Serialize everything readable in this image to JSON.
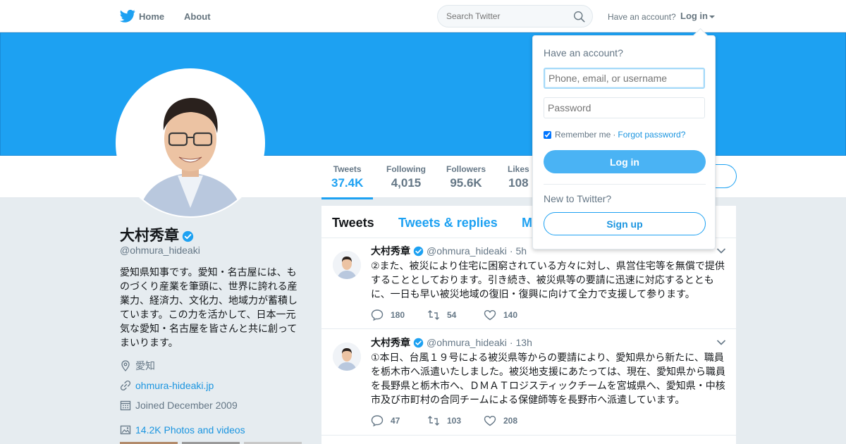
{
  "nav": {
    "home_label": "Home",
    "about_label": "About",
    "search_placeholder": "Search Twitter",
    "have_account": "Have an account?",
    "login_label": "Log in"
  },
  "profile": {
    "name": "大村秀章",
    "handle": "@ohmura_hideaki",
    "bio": "愛知県知事です。愛知・名古屋には、ものづくり産業を筆頭に、世界に誇れる産業力、経済力、文化力、地域力が蓄積しています。この力を活かして、日本一元気な愛知・名古屋を皆さんと共に創ってまいります。",
    "location": "愛知",
    "website": "ohmura-hideaki.jp",
    "joined": "Joined December 2009",
    "photos": "14.2K Photos and videos"
  },
  "stats": [
    {
      "label": "Tweets",
      "value": "37.4K"
    },
    {
      "label": "Following",
      "value": "4,015"
    },
    {
      "label": "Followers",
      "value": "95.6K"
    },
    {
      "label": "Likes",
      "value": "108"
    }
  ],
  "tabs": [
    "Tweets",
    "Tweets & replies",
    "M"
  ],
  "tweets": [
    {
      "name": "大村秀章",
      "handle": "@ohmura_hideaki",
      "sep": "·",
      "time": "5h",
      "text": "②また、被災により住宅に困窮されている方々に対し、県営住宅等を無償で提供することとしております。引き続き、被災県等の要請に迅速に対応するとともに、一日も早い被災地域の復旧・復興に向けて全力で支援して参ります。",
      "replies": "180",
      "retweets": "54",
      "likes": "140"
    },
    {
      "name": "大村秀章",
      "handle": "@ohmura_hideaki",
      "sep": "·",
      "time": "13h",
      "text": "①本日、台風１９号による被災県等からの要請により、愛知県から新たに、職員を栃木市へ派遣いたしました。被災地支援にあたっては、現在、愛知県から職員を長野県と栃木市へ、ＤＭＡＴロジスティックチームを宮城県へ、愛知県・中核市及び市町村の合同チームによる保健師等を長野市へ派遣しています。",
      "replies": "47",
      "retweets": "103",
      "likes": "208"
    }
  ],
  "login_dropdown": {
    "title": "Have an account?",
    "username_placeholder": "Phone, email, or username",
    "password_placeholder": "Password",
    "remember": "Remember me",
    "dot": "·",
    "forgot": "Forgot password?",
    "login_button": "Log in",
    "new_to": "New to Twitter?",
    "signup_button": "Sign up"
  },
  "colors": {
    "brand": "#1da1f2",
    "link": "#1b95e0",
    "muted": "#657786"
  }
}
